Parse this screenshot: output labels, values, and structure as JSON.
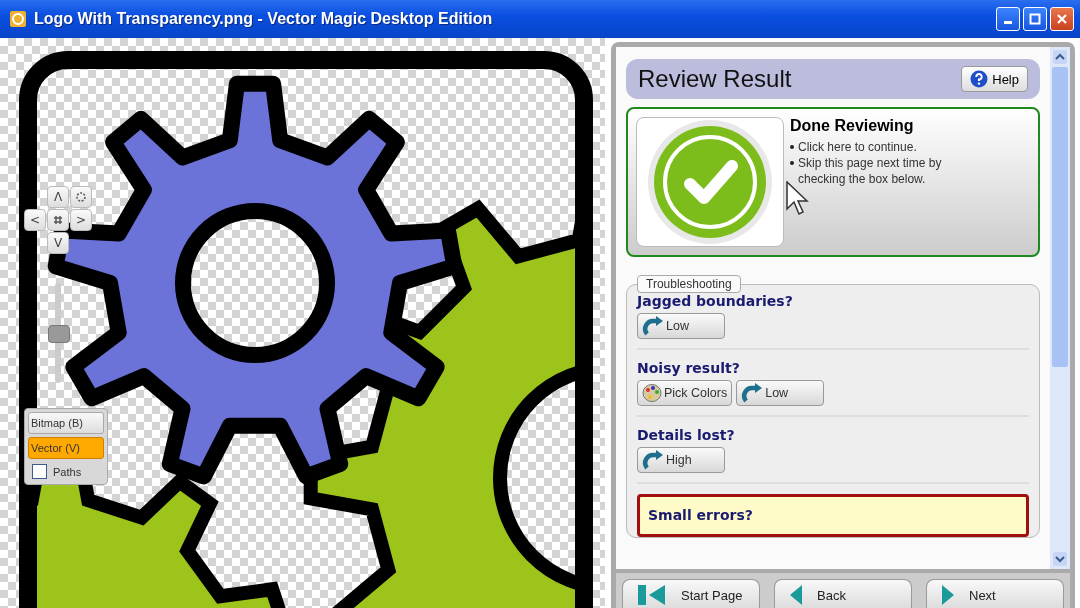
{
  "window": {
    "title": "Logo With Transparency.png - Vector Magic Desktop Edition"
  },
  "navigator": {
    "up": "Λ",
    "left": "<",
    "right": ">",
    "down": "V"
  },
  "zoom_slider": {
    "level": 0.5
  },
  "view_modes": [
    {
      "label": "Bitmap (B)",
      "selected": false
    },
    {
      "label": "Vector (V)",
      "selected": true
    }
  ],
  "paths_option": {
    "label": "Paths",
    "checked": false
  },
  "panel": {
    "title": "Review Result",
    "help_button": "Help",
    "done_card": {
      "title": "Done Reviewing",
      "bullets": [
        "Click here to continue.",
        "Skip this page next time by checking the box below."
      ]
    },
    "troubleshooting": {
      "legend": "Troubleshooting",
      "sections": [
        {
          "question": "Jagged boundaries?",
          "buttons": [
            {
              "label": "Low",
              "kind": "redo"
            }
          ]
        },
        {
          "question": "Noisy result?",
          "buttons": [
            {
              "label": "Pick Colors",
              "kind": "palette"
            },
            {
              "label": "Low",
              "kind": "redo"
            }
          ]
        },
        {
          "question": "Details lost?",
          "buttons": [
            {
              "label": "High",
              "kind": "redo"
            }
          ]
        }
      ],
      "alert": {
        "question": "Small errors?"
      }
    }
  },
  "nav_buttons": [
    {
      "label": "Start Page",
      "kind": "start"
    },
    {
      "label": "Back",
      "kind": "back"
    },
    {
      "label": "Next",
      "kind": "next"
    }
  ]
}
